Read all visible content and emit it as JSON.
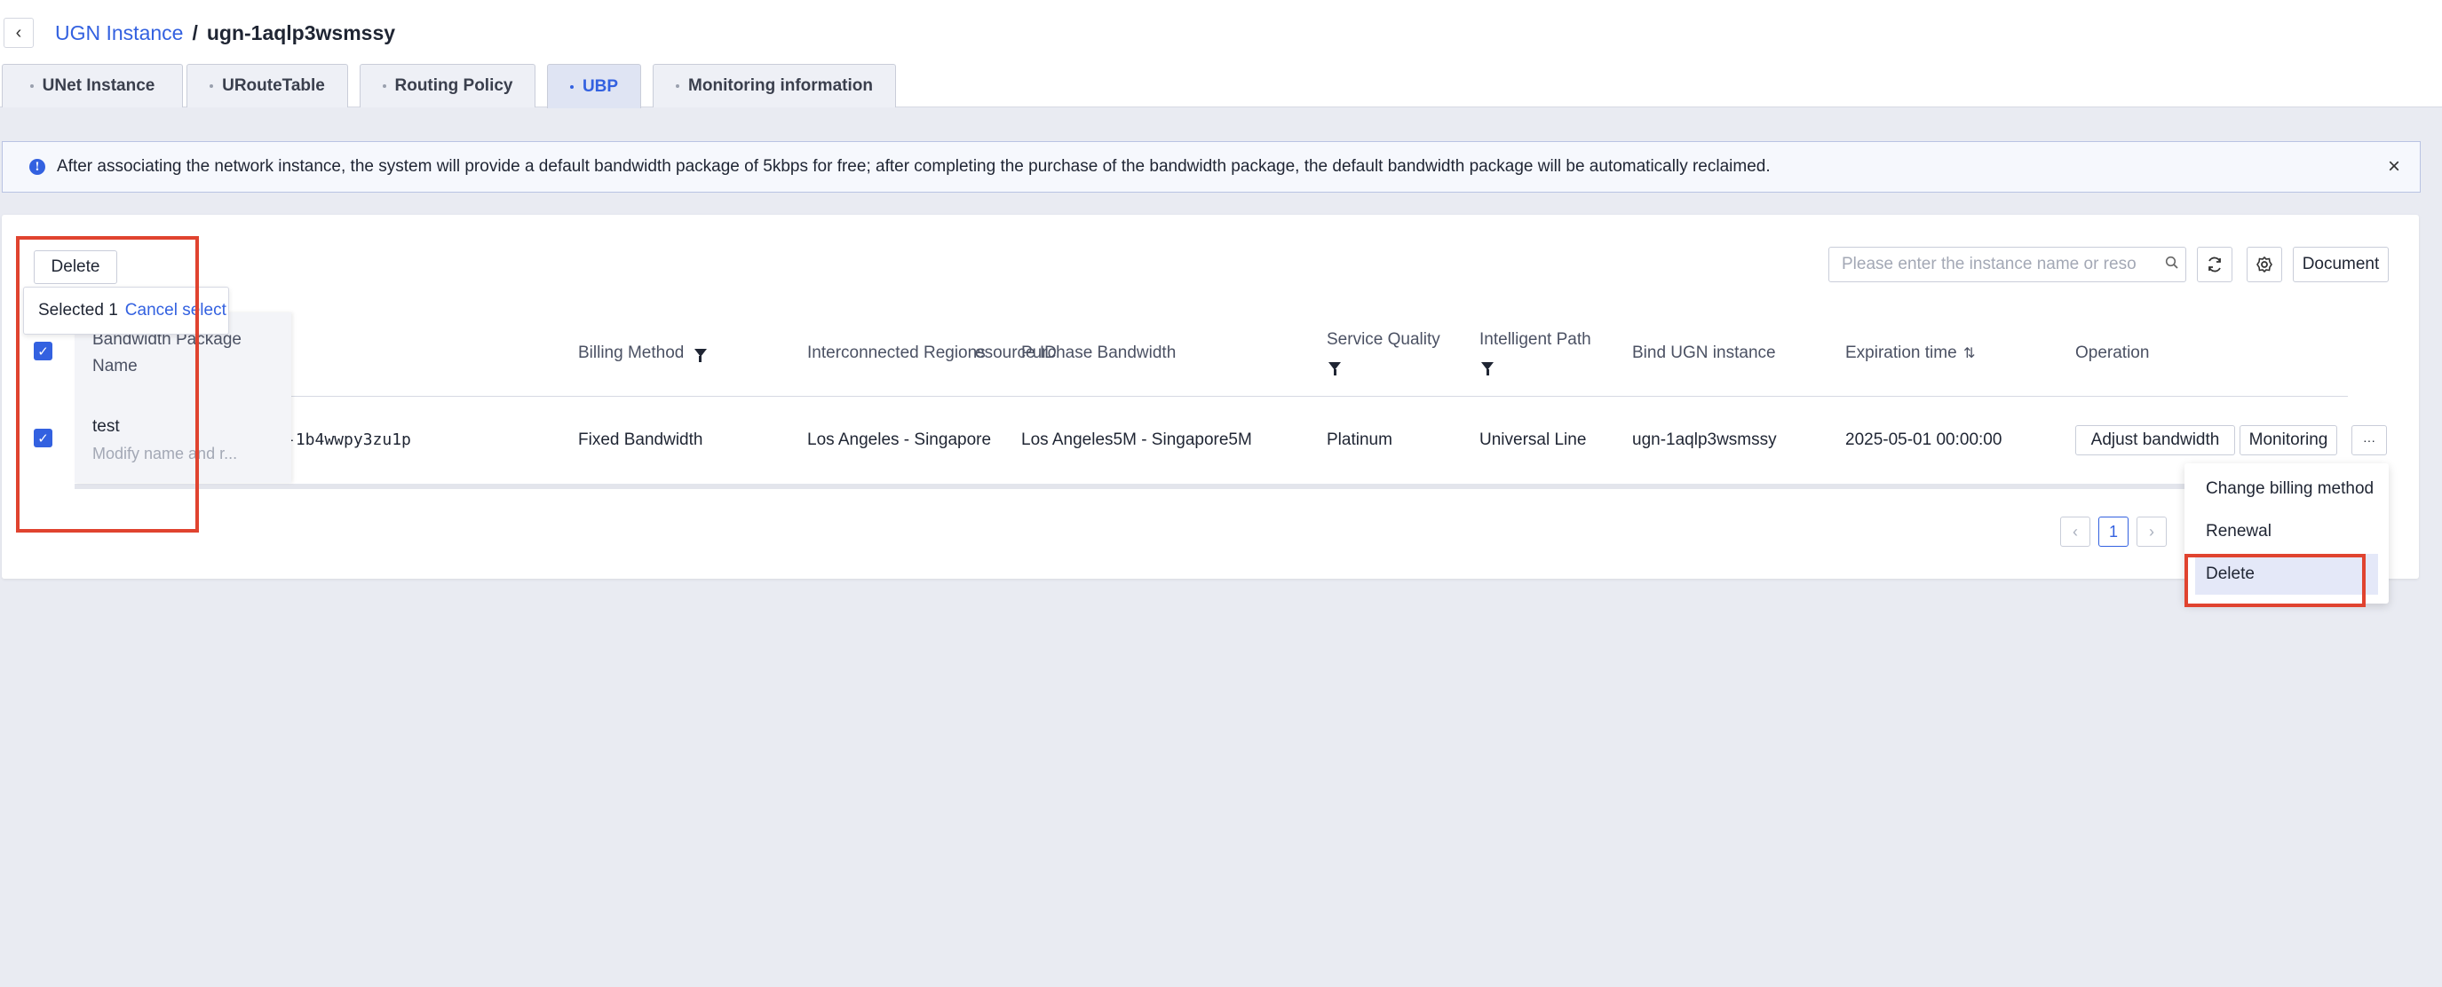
{
  "breadcrumb": {
    "parent": "UGN Instance",
    "separator": "/",
    "current": "ugn-1aqlp3wsmssy"
  },
  "tabs": [
    {
      "label": "UNet Instance"
    },
    {
      "label": "URouteTable"
    },
    {
      "label": "Routing Policy"
    },
    {
      "label": "UBP",
      "active": true
    },
    {
      "label": "Monitoring information"
    }
  ],
  "notice": {
    "text": "After associating the network instance, the system will provide a default bandwidth package of 5kbps for free; after completing the purchase of the bandwidth package, the default bandwidth package will be automatically reclaimed.",
    "close": "×"
  },
  "toolbar": {
    "delete_label": "Delete",
    "search_placeholder": "Please enter the instance name or reso",
    "document_label": "Document"
  },
  "selection": {
    "selected_text": "Selected 1",
    "cancel_label": "Cancel select"
  },
  "table": {
    "columns": {
      "name_line1": "Bandwidth Package",
      "name_line2": "Name",
      "resource_id": "esource ID",
      "billing": "Billing Method",
      "regions": "Interconnected Regions",
      "purchase_bw": "Purchase Bandwidth",
      "quality": "Service Quality",
      "path": "Intelligent Path",
      "bind": "Bind UGN instance",
      "expiry": "Expiration time",
      "operation": "Operation"
    },
    "row": {
      "name": "test",
      "name_hint": "Modify name and r...",
      "resource_id": "-1b4wwpy3zu1p",
      "billing": "Fixed Bandwidth",
      "regions": "Los Angeles - Singapore",
      "purchase_bw": "Los Angeles5M - Singapore5M",
      "quality": "Platinum",
      "path": "Universal Line",
      "bind": "ugn-1aqlp3wsmssy",
      "expiry": "2025-05-01 00:00:00",
      "adjust_label": "Adjust bandwidth",
      "monitor_label": "Monitoring",
      "more_label": "···"
    }
  },
  "more_menu": [
    "Change billing method",
    "Renewal",
    "Delete"
  ],
  "pager": {
    "prev": "‹",
    "page": "1",
    "next": "›"
  },
  "colors": {
    "accent": "#3361e0",
    "highlight_border": "#e0432f"
  }
}
